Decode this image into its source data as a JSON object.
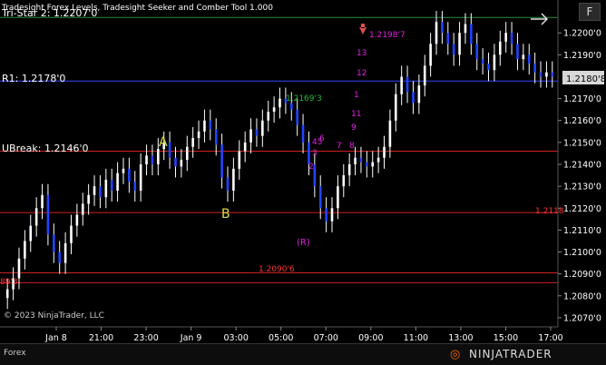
{
  "window": {
    "title": "Tradesight Forex Levels, Tradesight Seeker and Comber Tool 1.000",
    "f_button": "F",
    "tab_label": "Forex",
    "copyright": "© 2023 NinjaTrader, LLC",
    "brand": "NINJATRADER",
    "arrow_icon": "right-arrow-icon"
  },
  "levels": [
    {
      "label": "Tri-Star 2: 1.2207'0",
      "value": 1.2207,
      "color": "#2e8b3a"
    },
    {
      "label": "R1: 1.2178'0",
      "value": 1.2178,
      "color": "#3344ff"
    },
    {
      "label": "UBreak: 1.2146'0",
      "value": 1.2146,
      "color": "#cc2222"
    },
    {
      "label": "",
      "value": 1.2118,
      "color": "#cc2222"
    },
    {
      "label": "",
      "value": 1.20905,
      "color": "#cc2222"
    },
    {
      "label": "",
      "value": 1.2086,
      "color": "#cc2222"
    }
  ],
  "price_axis": {
    "ticks": [
      "1.2200'0",
      "1.2190'0",
      "1.2170'0",
      "1.2160'0",
      "1.2150'0",
      "1.2140'0",
      "1.2130'0",
      "1.2120'0",
      "1.2110'0",
      "1.2100'0",
      "1.2090'0",
      "1.2080'0",
      "1.2070'0"
    ],
    "current_price": "1.2180'8",
    "current_color": "#ffffff"
  },
  "time_axis": {
    "ticks": [
      "Jan 8",
      "21:00",
      "23:00",
      "Jan 9",
      "03:00",
      "05:00",
      "07:00",
      "09:00",
      "11:00",
      "13:00",
      "15:00",
      "17:00"
    ]
  },
  "annotations": {
    "A": "A",
    "B": "B",
    "R": "(R)",
    "level_2169": "1.2169'3",
    "level_2198": "1.2198'7",
    "level_2118": "1.2118",
    "level_2090": "1.2090'6",
    "level_left": "89'3",
    "seq_13": "13",
    "seq_12": "12",
    "seq_1": "1",
    "seq_11": "11",
    "seq_9": "9",
    "seq_8": "8",
    "seq_7": "7",
    "seq_45": "45",
    "seq_6": "6",
    "seq_3": "3",
    "seq_2": "2"
  },
  "chart_data": {
    "type": "candlestick",
    "xlabel": "",
    "ylabel": "",
    "ylim": [
      1.2065,
      1.2215
    ],
    "closes": [
      1.2083,
      1.2088,
      1.2097,
      1.2105,
      1.2112,
      1.212,
      1.2126,
      1.2108,
      1.21,
      1.2095,
      1.2104,
      1.2112,
      1.2117,
      1.2122,
      1.2126,
      1.213,
      1.2125,
      1.2133,
      1.2128,
      1.2136,
      1.2138,
      1.2132,
      1.2128,
      1.214,
      1.2144,
      1.214,
      1.2147,
      1.215,
      1.2143,
      1.2139,
      1.2142,
      1.2148,
      1.2152,
      1.2155,
      1.216,
      1.2156,
      1.2149,
      1.2134,
      1.2128,
      1.2138,
      1.2146,
      1.215,
      1.2156,
      1.2153,
      1.216,
      1.2164,
      1.2166,
      1.217,
      1.2168,
      1.2165,
      1.2158,
      1.215,
      1.214,
      1.213,
      1.212,
      1.2114,
      1.212,
      1.213,
      1.2135,
      1.214,
      1.2143,
      1.2141,
      1.2139,
      1.2141,
      1.2143,
      1.2148,
      1.216,
      1.2172,
      1.218,
      1.2173,
      1.2168,
      1.2176,
      1.2185,
      1.2195,
      1.2205,
      1.22,
      1.2195,
      1.219,
      1.22,
      1.2204,
      1.2195,
      1.2188,
      1.2186,
      1.2183,
      1.219,
      1.2196,
      1.22,
      1.2195,
      1.2188,
      1.219,
      1.2186,
      1.2182,
      1.218,
      1.2182,
      1.218
    ]
  }
}
